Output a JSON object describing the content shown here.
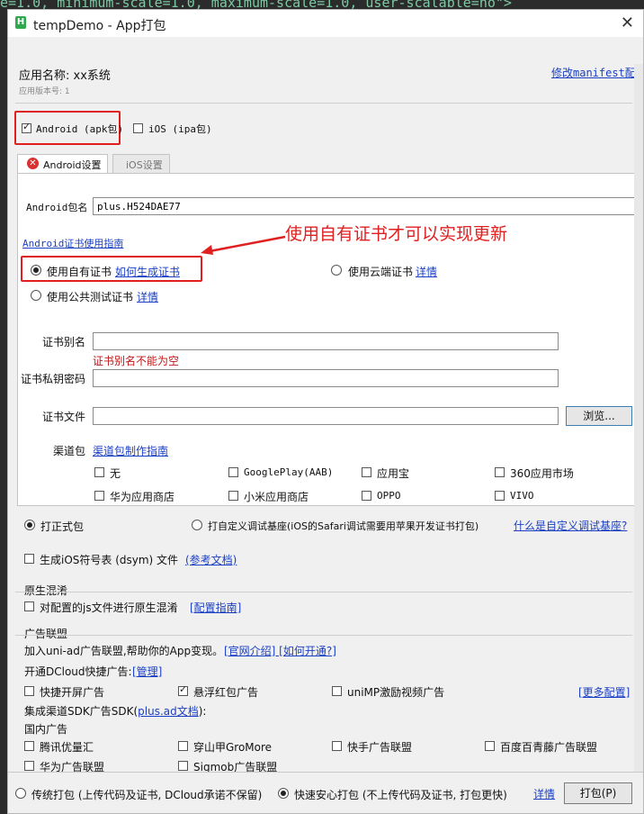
{
  "background_code": "e=1.0, minimum-scale=1.0, maximum-scale=1.0, user-scalable=no\">",
  "window": {
    "title": "tempDemo - App打包",
    "icon": "hbuilder-h-icon"
  },
  "app": {
    "name_label": "应用名称: xx系统",
    "version_label": "应用版本号: 1",
    "manifest_link": "修改manifest配置"
  },
  "platforms": {
    "android": {
      "label": "Android (apk包)",
      "checked": true
    },
    "ios": {
      "label": "iOS (ipa包)",
      "checked": false
    }
  },
  "tabs": [
    {
      "label": "Android设置",
      "active": true
    },
    {
      "label": "iOS设置",
      "active": false
    }
  ],
  "android": {
    "package_label": "Android包名",
    "package_value": "plus.H524DAE77",
    "cert_guide_link": "Android证书使用指南",
    "annotation": "使用自有证书才可以实现更新",
    "cert_options": {
      "own": {
        "label": "使用自有证书",
        "link": "如何生成证书",
        "checked": true
      },
      "cloud": {
        "label": "使用云端证书",
        "link": "详情",
        "checked": false
      },
      "public": {
        "label": "使用公共测试证书",
        "link": "详情",
        "checked": false
      }
    },
    "alias_label": "证书别名",
    "alias_error": "证书别名不能为空",
    "password_label": "证书私钥密码",
    "file_label": "证书文件",
    "browse_button": "浏览...",
    "channel_label": "渠道包",
    "channel_link": "渠道包制作指南",
    "channels": [
      {
        "label": "无",
        "checked": false
      },
      {
        "label": "GooglePlay(AAB)",
        "checked": false
      },
      {
        "label": "应用宝",
        "checked": false
      },
      {
        "label": "360应用市场",
        "checked": false
      },
      {
        "label": "华为应用商店",
        "checked": false
      },
      {
        "label": "小米应用商店",
        "checked": false
      },
      {
        "label": "OPPO",
        "checked": false
      },
      {
        "label": "VIVO",
        "checked": false
      }
    ]
  },
  "build_type": {
    "formal": {
      "label": "打正式包",
      "checked": true
    },
    "custom": {
      "label": "打自定义调试基座(iOS的Safari调试需要用苹果开发证书打包)",
      "checked": false
    },
    "custom_link": "什么是自定义调试基座?"
  },
  "dsym": {
    "label": "生成iOS符号表 (dsym) 文件",
    "link": "(参考文档)",
    "checked": false
  },
  "native_obfuscation": {
    "group_title": "原生混淆",
    "label": "对配置的js文件进行原生混淆",
    "link": "[配置指南]",
    "checked": false
  },
  "ads": {
    "group_title": "广告联盟",
    "join_text": "加入uni-ad广告联盟,帮助你的App变现。",
    "join_link": "[官网介绍] [如何开通?]",
    "dcloud_label": "开通DCloud快捷广告:",
    "dcloud_link": "[管理]",
    "quick_options": [
      {
        "label": "快捷开屏广告",
        "checked": false
      },
      {
        "label": "悬浮红包广告",
        "checked": true
      },
      {
        "label": "uniMP激励视频广告",
        "checked": false
      }
    ],
    "more_link": "[更多配置]",
    "sdk_prefix": "集成渠道SDK广告SDK(",
    "sdk_link": "plus.ad文档",
    "sdk_suffix": "):",
    "domestic_label": "国内广告",
    "domestic": [
      {
        "label": "腾讯优量汇",
        "checked": false
      },
      {
        "label": "穿山甲GroMore",
        "checked": false
      },
      {
        "label": "快手广告联盟",
        "checked": false
      },
      {
        "label": "百度百青藤广告联盟",
        "checked": false
      },
      {
        "label": "华为广告联盟",
        "checked": false
      },
      {
        "label": "Sigmob广告联盟",
        "checked": false
      }
    ]
  },
  "footer": {
    "traditional": {
      "label": "传统打包 (上传代码及证书, DCloud承诺不保留)",
      "checked": false
    },
    "fast": {
      "label": "快速安心打包 (不上传代码及证书, 打包更快)",
      "checked": true
    },
    "details_link": "详情",
    "build_button": "打包(P)"
  }
}
